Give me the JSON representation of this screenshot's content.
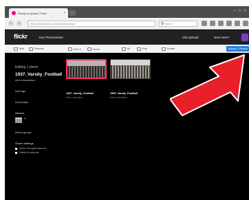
{
  "browser": {
    "tab_title": "Ready to upload | Flickr",
    "tab_close": "×",
    "url": "https://www.flickr.com/photos/upload/",
    "search_placeholder": "Search",
    "window_controls": [
      "–",
      "□",
      "×"
    ],
    "nav": {
      "back": "‹",
      "forward": "›"
    }
  },
  "header": {
    "logo": "flickr",
    "nav_link": "Your Photostream",
    "old_uploadr": "Old Uploadr",
    "new_here": "New Here?"
  },
  "toolbar": {
    "add": "Add",
    "remove": "Remove",
    "size": "Size ▾",
    "sort": "Sort ▾",
    "all": "All",
    "edit": "Edit",
    "rotate": "Rotate",
    "upload_button": "Upload 2 Photos"
  },
  "panel": {
    "editing_label": "Editing 1 photo",
    "photo_title": "1937_Varsity_Football",
    "add_description": "Add a description",
    "add_tags": "Add tags",
    "add_people": "Add people",
    "albums_label": "Albums",
    "album_plus": "+",
    "add_to_groups": "Add to groups",
    "owner_settings": "Owner settings",
    "license": "Some / All rights reserved",
    "visibility": "Visible to everyone"
  },
  "photos": [
    {
      "name": "1937_Varsity_Football",
      "description": "Add a description",
      "selected": true
    },
    {
      "name": "1955_Varsity_Football",
      "description": "Add a description",
      "selected": false
    }
  ],
  "colors": {
    "flickr_pink": "#ff0084",
    "selection": "#ff2c72",
    "upload_blue": "#1f7fe0",
    "arrow_red": "#e8202a"
  }
}
